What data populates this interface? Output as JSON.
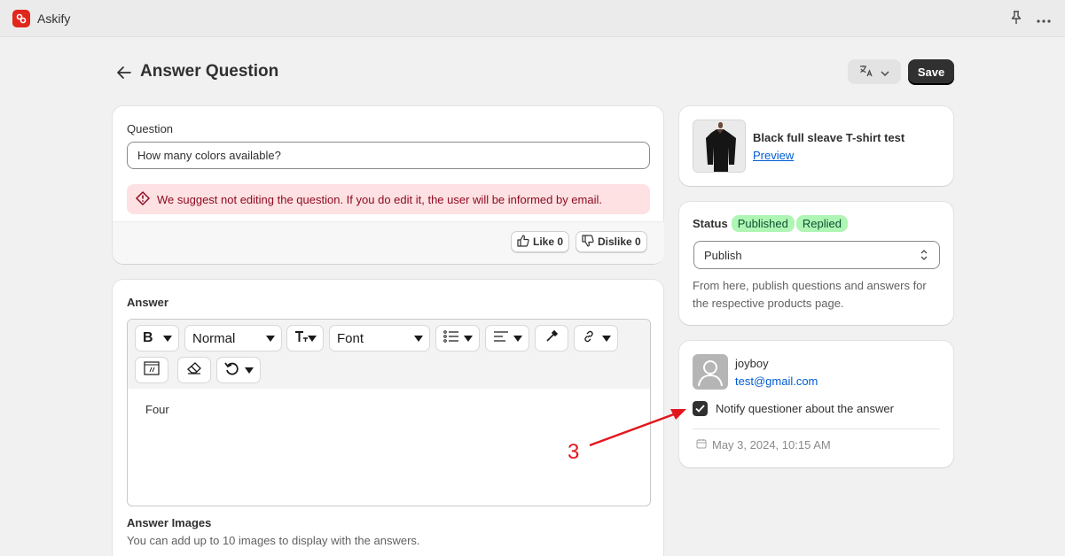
{
  "topbar": {
    "app_name": "Askify",
    "pin_icon": "pin-icon",
    "more_icon": "more-horizontal-icon"
  },
  "header": {
    "title": "Answer Question",
    "save_label": "Save",
    "translate_icon": "translate-icon"
  },
  "question_card": {
    "label": "Question",
    "value": "How many colors available?",
    "warning": "We suggest not editing the question. If you do edit it, the user will be informed by email.",
    "like_label": "Like 0",
    "dislike_label": "Dislike 0"
  },
  "answer_card": {
    "label": "Answer",
    "toolbar": {
      "bold": "B",
      "paragraph_style": "Normal",
      "font": "Font"
    },
    "content": "Four",
    "images_label": "Answer Images",
    "images_help": "You can add up to 10 images to display with the answers."
  },
  "product_card": {
    "name": "Black full sleave T-shirt test",
    "preview_label": "Preview"
  },
  "status_card": {
    "label": "Status",
    "badges": [
      "Published",
      "Replied"
    ],
    "select_value": "Publish",
    "help": "From here, publish questions and answers for the respective products page."
  },
  "user_card": {
    "username": "joyboy",
    "email": "test@gmail.com",
    "notify_label": "Notify questioner about the answer",
    "notify_checked": true,
    "date": "May 3, 2024, 10:15 AM"
  },
  "annotation": {
    "number": "3",
    "color": "#e3161e"
  }
}
